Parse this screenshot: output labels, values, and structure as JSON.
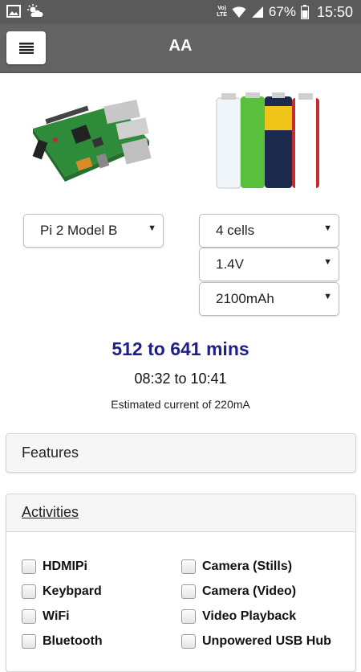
{
  "status_bar": {
    "battery": "67%",
    "time": "15:50",
    "network_line1": "Vo)",
    "network_line2": "LTE"
  },
  "app_bar": {
    "title": "AA",
    "menu_icon": "hamburger-icon"
  },
  "images": {
    "board": "raspberry-pi-board-image",
    "batteries": "aa-batteries-image"
  },
  "selectors": {
    "model": "Pi 2 Model B",
    "cells": "4 cells",
    "voltage": "1.4V",
    "capacity": "2100mAh"
  },
  "result": {
    "mins": "512 to 641 mins",
    "time_range": "08:32 to 10:41",
    "current": "Estimated current of 220mA"
  },
  "features": {
    "title": "Features"
  },
  "activities": {
    "title": "Activities",
    "left": [
      "HDMIPi",
      "Keybpard",
      "WiFi",
      "Bluetooth"
    ],
    "right": [
      "Camera (Stills)",
      "Camera (Video)",
      "Video Playback",
      "Unpowered USB Hub"
    ]
  }
}
